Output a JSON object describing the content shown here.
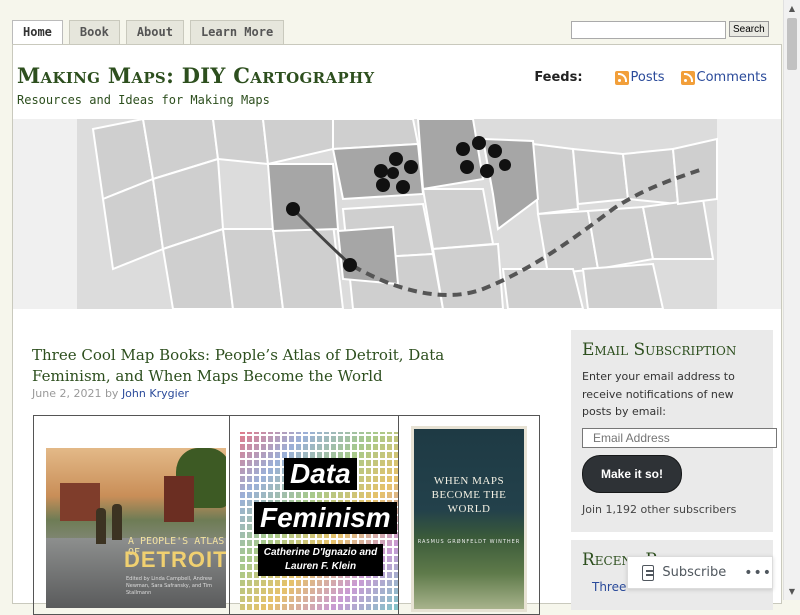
{
  "nav": {
    "tabs": [
      {
        "label": "Home",
        "active": true
      },
      {
        "label": "Book"
      },
      {
        "label": "About"
      },
      {
        "label": "Learn More"
      }
    ]
  },
  "search": {
    "placeholder": "",
    "value": "",
    "button_label": "Search"
  },
  "header": {
    "title": "Making Maps: DIY Cartography",
    "tagline": "Resources and Ideas for Making Maps",
    "feeds_label": "Feeds:",
    "feed_posts": "Posts",
    "feed_comments": "Comments"
  },
  "post": {
    "title": "Three Cool Map Books: People’s Atlas of Detroit, Data Feminism, and When Maps Become the World",
    "date": "June 2, 2021",
    "by": "by",
    "author": "John Krygier",
    "books": [
      {
        "line1": "A PEOPLE'S ATLAS OF",
        "line2": "DETROIT",
        "editors": "Edited by Linda Campbell, Andrew Newman, Sara Safransky, and Tim Stallmann"
      },
      {
        "line1": "Data",
        "line2": "Feminism",
        "authors": "Catherine D'Ignazio and Lauren F. Klein"
      },
      {
        "title": "WHEN MAPS BECOME THE WORLD",
        "author": "RASMUS GRØNFELDT WINTHER"
      }
    ]
  },
  "sidebar": {
    "email": {
      "title": "Email Subscription",
      "text": "Enter your email address to receive notifications of new posts by email:",
      "placeholder": "Email Address",
      "button_label": "Make it so!",
      "count_text": "Join 1,192 other subscribers"
    },
    "recent": {
      "title": "Recent Posts",
      "first_item": "Three"
    }
  },
  "float_subscribe": {
    "label": "Subscribe",
    "more": "•••"
  },
  "icons": {
    "feed": "rss-icon",
    "reader": "reader-icon",
    "bomb": "bomb-icon",
    "scroll_up": "scroll-up-arrow-icon",
    "scroll_down": "scroll-down-arrow-icon"
  }
}
